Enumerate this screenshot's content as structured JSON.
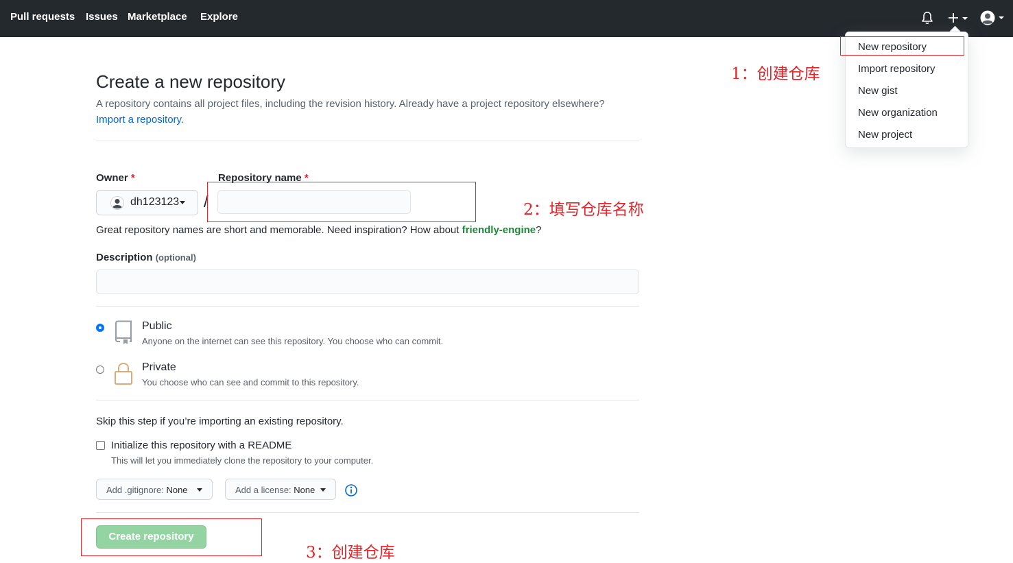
{
  "nav": {
    "links": [
      "Pull requests",
      "Issues",
      "Marketplace",
      "Explore"
    ]
  },
  "dropdown": {
    "items": [
      "New repository",
      "Import repository",
      "New gist",
      "New organization",
      "New project"
    ]
  },
  "annotations": {
    "step1": "1：创建仓库",
    "step2": "2：填写仓库名称",
    "step3": "3：创建仓库"
  },
  "page": {
    "title": "Create a new repository",
    "subtitle": "A repository contains all project files, including the revision history. Already have a project repository elsewhere?",
    "import_link": "Import a repository."
  },
  "form": {
    "owner_label": "Owner",
    "required_mark": "*",
    "owner_value": "dh123123",
    "slash": "/",
    "repo_name_label": "Repository name",
    "repo_name_value": "",
    "hint_prefix": "Great repository names are short and memorable. Need inspiration? How about ",
    "hint_suggestion": "friendly-engine",
    "hint_suffix": "?",
    "description_label": "Description",
    "description_optional": "(optional)",
    "description_value": ""
  },
  "visibility": {
    "public_label": "Public",
    "public_desc": "Anyone on the internet can see this repository. You choose who can commit.",
    "private_label": "Private",
    "private_desc": "You choose who can see and commit to this repository.",
    "selected": "public"
  },
  "init": {
    "skip_text": "Skip this step if you’re importing an existing repository.",
    "readme_label": "Initialize this repository with a README",
    "readme_desc": "This will let you immediately clone the repository to your computer.",
    "readme_checked": false,
    "gitignore_prefix": "Add .gitignore: ",
    "gitignore_value": "None",
    "license_prefix": "Add a license: ",
    "license_value": "None"
  },
  "submit": {
    "label": "Create repository"
  },
  "colors": {
    "header_bg": "#24292e",
    "link": "#0366d6",
    "annotation_red": "#e0262b",
    "create_button_disabled": "#94d3a2",
    "suggestion_green": "#22863a"
  }
}
